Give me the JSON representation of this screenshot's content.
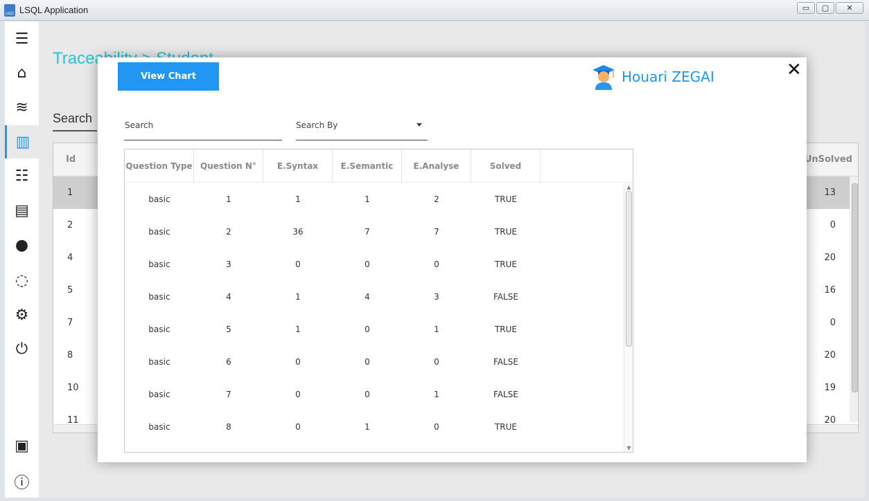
{
  "window": {
    "title": "LSQL Application",
    "minimize": "▭",
    "maximize": "▢",
    "close": "✕"
  },
  "sidebar": {
    "items": [
      {
        "icon": "menu-icon",
        "glyph": "☰"
      },
      {
        "icon": "home-icon",
        "glyph": "⌂"
      },
      {
        "icon": "wifi-icon",
        "glyph": "≋"
      },
      {
        "icon": "chart-icon",
        "glyph": "▥",
        "active": true
      },
      {
        "icon": "checklist-icon",
        "glyph": "☷"
      },
      {
        "icon": "clipboard-icon",
        "glyph": "▤"
      },
      {
        "icon": "users-icon",
        "glyph": "●"
      },
      {
        "icon": "chat-icon",
        "glyph": "◌"
      },
      {
        "icon": "gear-icon",
        "glyph": "⚙"
      },
      {
        "icon": "power-icon",
        "glyph": "⏻"
      },
      {
        "icon": "display-icon",
        "glyph": "▣"
      },
      {
        "icon": "info-icon",
        "glyph": "ⓘ"
      }
    ]
  },
  "background": {
    "title": "Traceability > Student",
    "search_label": "Search",
    "table": {
      "col_id": "Id",
      "col_unsolved": "UnSolved",
      "rows": [
        {
          "id": "1",
          "unsolved": "13"
        },
        {
          "id": "2",
          "unsolved": "0"
        },
        {
          "id": "4",
          "unsolved": "20"
        },
        {
          "id": "5",
          "unsolved": "16"
        },
        {
          "id": "7",
          "unsolved": "0"
        },
        {
          "id": "8",
          "unsolved": "20"
        },
        {
          "id": "10",
          "unsolved": "19"
        },
        {
          "id": "11",
          "unsolved": "20"
        }
      ]
    }
  },
  "modal": {
    "view_chart_label": "View Chart",
    "user_name": "Houari ZEGAI",
    "close_glyph": "✕",
    "search_placeholder": "Search",
    "search_by_label": "Search By",
    "columns": [
      "Question Type",
      "Question N°",
      "E.Syntax",
      "E.Semantic",
      "E.Analyse",
      "Solved"
    ],
    "rows": [
      [
        "basic",
        "1",
        "1",
        "1",
        "2",
        "TRUE"
      ],
      [
        "basic",
        "2",
        "36",
        "7",
        "7",
        "TRUE"
      ],
      [
        "basic",
        "3",
        "0",
        "0",
        "0",
        "TRUE"
      ],
      [
        "basic",
        "4",
        "1",
        "4",
        "3",
        "FALSE"
      ],
      [
        "basic",
        "5",
        "1",
        "0",
        "1",
        "TRUE"
      ],
      [
        "basic",
        "6",
        "0",
        "0",
        "0",
        "FALSE"
      ],
      [
        "basic",
        "7",
        "0",
        "0",
        "1",
        "FALSE"
      ],
      [
        "basic",
        "8",
        "0",
        "1",
        "0",
        "TRUE"
      ]
    ]
  },
  "colors": {
    "accent": "#2196f3",
    "title_cyan": "#26c6da"
  }
}
